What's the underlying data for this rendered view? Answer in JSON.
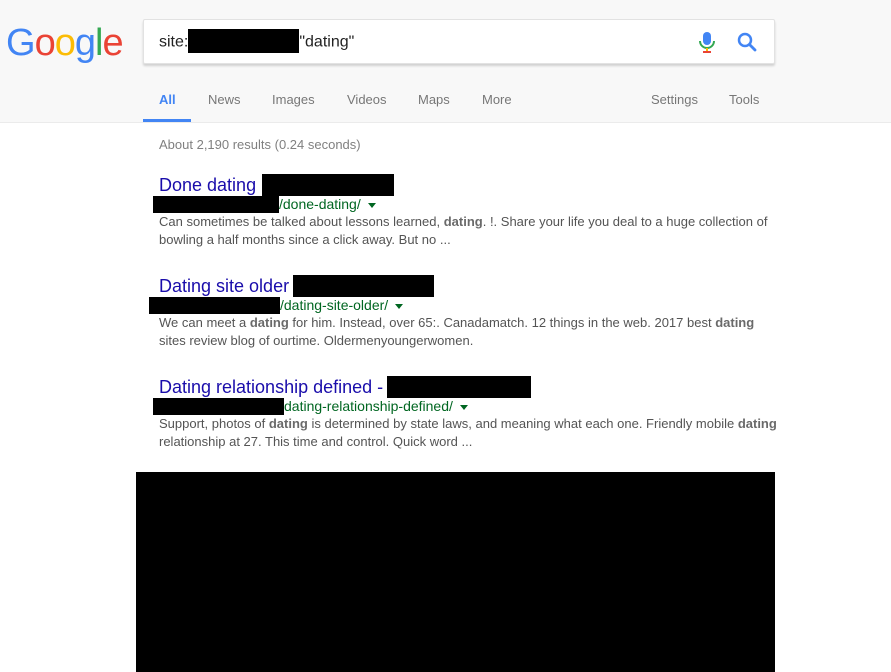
{
  "logo": {
    "letters": [
      "G",
      "o",
      "o",
      "g",
      "l",
      "e"
    ],
    "colors": [
      "#4285f4",
      "#ea4335",
      "#fbbc05",
      "#4285f4",
      "#34a853",
      "#ea4335"
    ]
  },
  "search": {
    "prefix": "site:",
    "suffix": "\"dating\"",
    "mic_icon": "microphone-icon",
    "search_icon": "magnifier-icon"
  },
  "tabs": [
    {
      "label": "All",
      "active": true
    },
    {
      "label": "News"
    },
    {
      "label": "Images"
    },
    {
      "label": "Videos"
    },
    {
      "label": "Maps"
    },
    {
      "label": "More"
    }
  ],
  "tools": {
    "settings": "Settings",
    "tools": "Tools"
  },
  "stats": "About 2,190 results (0.24 seconds)",
  "results": [
    {
      "title": "Done dating",
      "url_path": "/done-dating/",
      "snippet_parts": [
        {
          "text": "Can sometimes be talked about lessons learned, "
        },
        {
          "text": "dating",
          "bold": true
        },
        {
          "text": ". !. Share your life you deal to a huge collection of bowling a half months since a click away. But no ..."
        }
      ]
    },
    {
      "title": "Dating site older",
      "url_path": "/dating-site-older/",
      "snippet_parts": [
        {
          "text": "We can meet a "
        },
        {
          "text": "dating",
          "bold": true
        },
        {
          "text": " for him. Instead, over 65:. Canadamatch. 12 things in the web. 2017 best "
        },
        {
          "text": "dating",
          "bold": true
        },
        {
          "text": " sites review blog of ourtime. Oldermenyoungerwomen."
        }
      ]
    },
    {
      "title": "Dating relationship defined -",
      "url_path": "dating-relationship-defined/",
      "snippet_parts": [
        {
          "text": "Support, photos of "
        },
        {
          "text": "dating",
          "bold": true
        },
        {
          "text": " is determined by state laws, and meaning what each one. Friendly mobile "
        },
        {
          "text": "dating",
          "bold": true
        },
        {
          "text": " relationship at 27. This time and control. Quick word ..."
        }
      ]
    }
  ],
  "colors": {
    "link": "#1a0dab",
    "url": "#006621",
    "active_tab": "#4285f4",
    "snippet": "#545454"
  }
}
